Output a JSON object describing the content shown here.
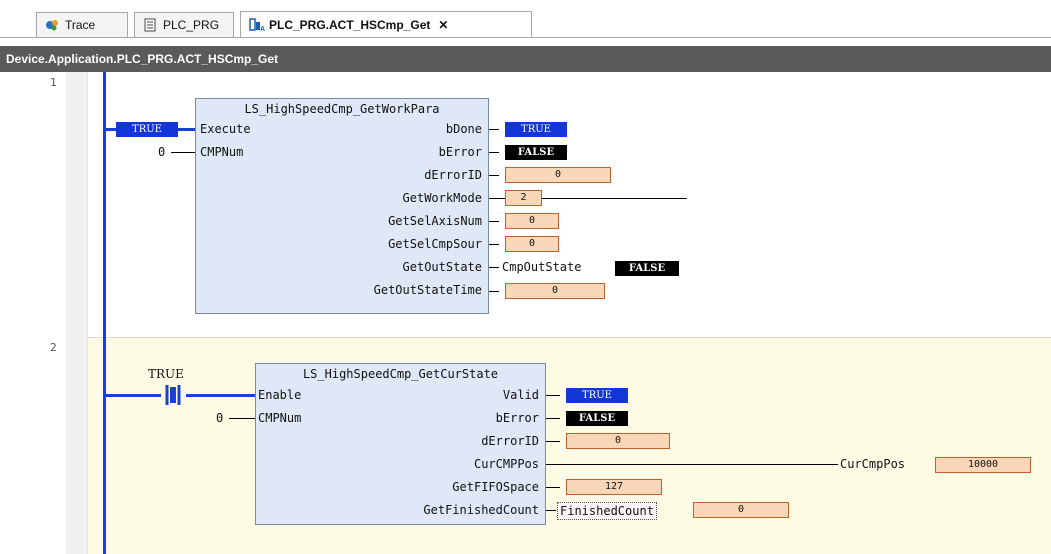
{
  "tabs": [
    {
      "label": "Trace",
      "icon": "trace-icon"
    },
    {
      "label": "PLC_PRG",
      "icon": "document-icon"
    },
    {
      "label": "PLC_PRG.ACT_HSCmp_Get",
      "icon": "action-icon",
      "close": "✕"
    }
  ],
  "path": "Device.Application.PLC_PRG.ACT_HSCmp_Get",
  "rungs": [
    {
      "number": "1",
      "block": {
        "title": "LS_HighSpeedCmp_GetWorkPara",
        "inputs": [
          {
            "pin": "Execute",
            "value": "TRUE"
          },
          {
            "pin": "CMPNum",
            "value": "0"
          }
        ],
        "outputs": [
          {
            "pin": "bDone",
            "value": "TRUE"
          },
          {
            "pin": "bError",
            "value": "FALSE"
          },
          {
            "pin": "dErrorID",
            "value": "0"
          },
          {
            "pin": "GetWorkMode",
            "value": "2"
          },
          {
            "pin": "GetSelAxisNum",
            "value": "0"
          },
          {
            "pin": "GetSelCmpSour",
            "value": "0"
          },
          {
            "pin": "GetOutState",
            "variable": "CmpOutState",
            "value": "FALSE"
          },
          {
            "pin": "GetOutStateTime",
            "value": "0"
          }
        ]
      }
    },
    {
      "number": "2",
      "contact": {
        "value": "TRUE"
      },
      "block": {
        "title": "LS_HighSpeedCmp_GetCurState",
        "inputs": [
          {
            "pin": "Enable"
          },
          {
            "pin": "CMPNum",
            "value": "0"
          }
        ],
        "outputs": [
          {
            "pin": "Valid",
            "value": "TRUE"
          },
          {
            "pin": "bError",
            "value": "FALSE"
          },
          {
            "pin": "dErrorID",
            "value": "0"
          },
          {
            "pin": "CurCMPPos",
            "variable": "CurCmpPos",
            "value": "10000"
          },
          {
            "pin": "GetFIFOSpace",
            "value": "127"
          },
          {
            "pin": "GetFinishedCount",
            "variable": "FinishedCount",
            "value": "0"
          }
        ]
      }
    }
  ]
}
